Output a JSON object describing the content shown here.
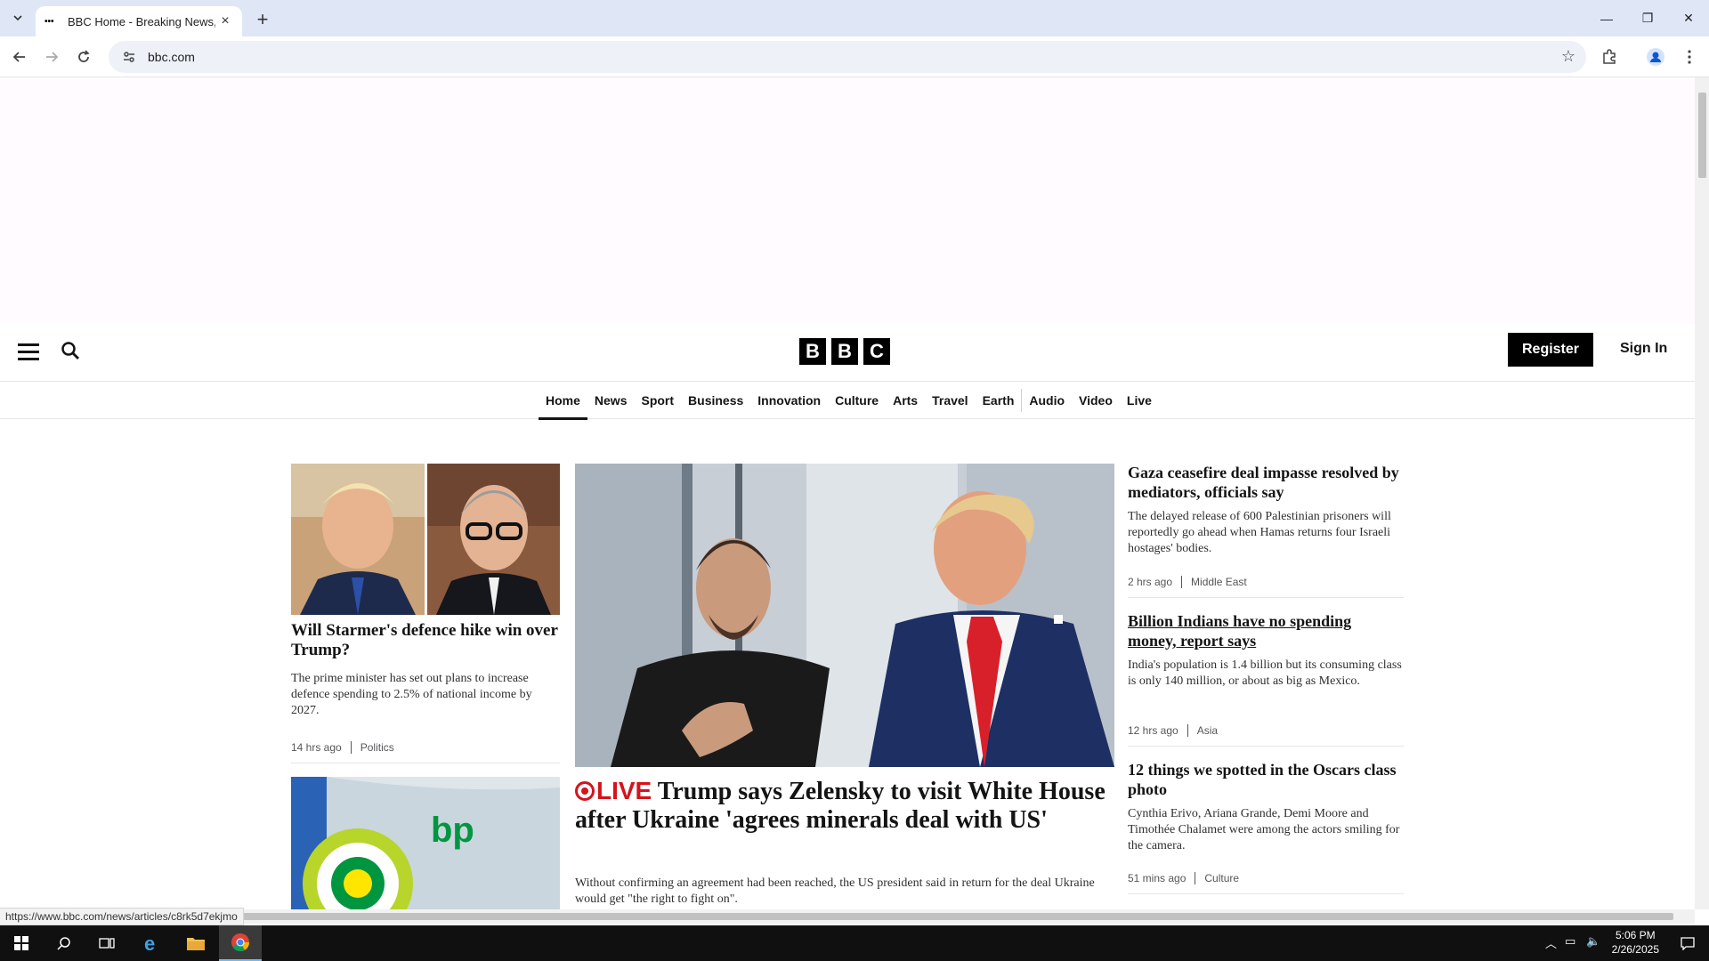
{
  "browser": {
    "tab_title": "BBC Home - Breaking News, W",
    "tab_favicon": "•••",
    "url": "bbc.com",
    "status_url": "https://www.bbc.com/news/articles/c8rk5d7ekjmo"
  },
  "masthead": {
    "logo_letters": [
      "B",
      "B",
      "C"
    ],
    "register_label": "Register",
    "signin_label": "Sign In"
  },
  "nav": {
    "items": [
      "Home",
      "News",
      "Sport",
      "Business",
      "Innovation",
      "Culture",
      "Arts",
      "Travel",
      "Earth",
      "Audio",
      "Video",
      "Live"
    ],
    "active": "Home"
  },
  "left_story": {
    "headline": "Will Starmer's defence hike win over Trump?",
    "summary": "The prime minister has set out plans to increase defence spending to 2.5% of national income by 2027.",
    "time": "14 hrs ago",
    "section": "Politics"
  },
  "bp_image_text": "bp",
  "center_story": {
    "live_label": "LIVE",
    "headline": "Trump says Zelensky to visit White House after Ukraine 'agrees minerals deal with US'",
    "summary": "Without confirming an agreement had been reached, the US president said in return for the deal Ukraine would get \"the right to fight on\"."
  },
  "right_stories": [
    {
      "headline": "Gaza ceasefire deal impasse resolved by mediators, officials say",
      "summary": "The delayed release of 600 Palestinian prisoners will reportedly go ahead when Hamas returns four Israeli hostages' bodies.",
      "time": "2 hrs ago",
      "section": "Middle East"
    },
    {
      "headline": "Billion Indians have no spending money, report says",
      "summary": "India's population is 1.4 billion but its consuming class is only 140 million, or about as big as Mexico.",
      "time": "12 hrs ago",
      "section": "Asia"
    },
    {
      "headline": "12 things we spotted in the Oscars class photo",
      "summary": "Cynthia Erivo, Ariana Grande, Demi Moore and Timothée Chalamet were among the actors smiling for the camera.",
      "time": "51 mins ago",
      "section": "Culture"
    }
  ],
  "taskbar": {
    "time": "5:06 PM",
    "date": "2/26/2025"
  },
  "colors": {
    "live_red": "#d4141b",
    "titlebar": "#dfe7f7",
    "ad_background": "#fffbfe"
  }
}
